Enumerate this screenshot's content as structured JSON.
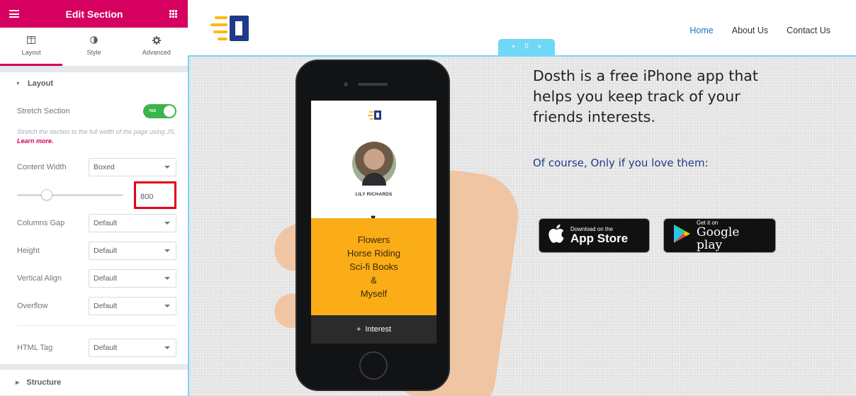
{
  "panel": {
    "title": "Edit Section",
    "tabs": [
      {
        "label": "Layout",
        "icon": "layout-icon",
        "active": true
      },
      {
        "label": "Style",
        "icon": "contrast-icon"
      },
      {
        "label": "Advanced",
        "icon": "gear-icon"
      }
    ],
    "layout_section": {
      "title": "Layout",
      "stretch_label": "Stretch Section",
      "stretch_toggle": "YES",
      "stretch_desc": "Stretch the section to the full width of the page using JS.",
      "learn_more": "Learn more.",
      "content_width_label": "Content Width",
      "content_width_value": "Boxed",
      "width_number": "800",
      "width_slider_fraction": 0.28,
      "columns_gap_label": "Columns Gap",
      "columns_gap_value": "Default",
      "height_label": "Height",
      "height_value": "Default",
      "vertical_align_label": "Vertical Align",
      "vertical_align_value": "Default",
      "overflow_label": "Overflow",
      "overflow_value": "Default",
      "html_tag_label": "HTML Tag",
      "html_tag_value": "Default"
    },
    "structure_section": {
      "title": "Structure"
    }
  },
  "site": {
    "nav": [
      "Home",
      "About Us",
      "Contact Us"
    ],
    "section_handle": {
      "add": "+",
      "drag": "⠿",
      "close": "×"
    },
    "headline": "Dosth is a free iPhone app that helps you keep track of your friends interests.",
    "subheadline": "Of course, Only if you love them:",
    "phone": {
      "user_name": "LILY RICHARDS",
      "interests": [
        "Flowers",
        "Horse Riding",
        "Sci-fi Books",
        "&",
        "Myself"
      ],
      "add_interest": "Interest"
    },
    "app_store": {
      "small": "Download on the",
      "big": "App Store"
    },
    "google_play": {
      "small": "Get it on",
      "big": "Google play"
    }
  },
  "colors": {
    "accent": "#d5005f",
    "highlight_box": "#e2001a",
    "toggle_on": "#39b54a",
    "section_outline": "#71d7f7",
    "nav_active": "#1a73c7",
    "subheadline": "#1f3d8a",
    "phone_yellow": "#fbad18"
  }
}
